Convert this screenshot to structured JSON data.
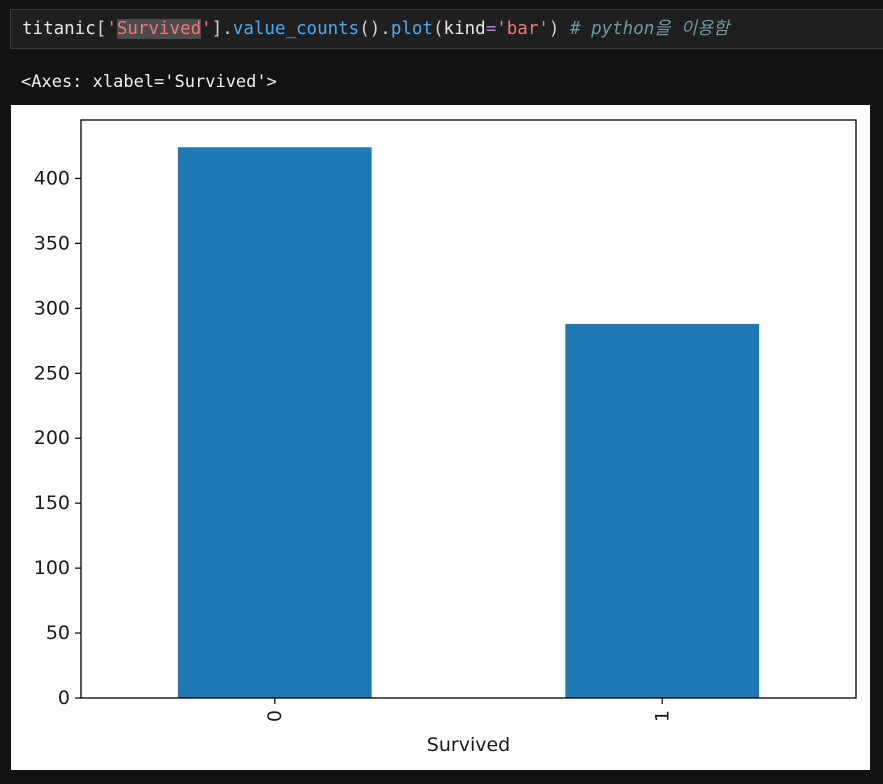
{
  "code_cell": {
    "tokens": [
      {
        "text": "titanic",
        "kind": "kw"
      },
      {
        "text": "[",
        "kind": "punc"
      },
      {
        "text": "'",
        "kind": "str"
      },
      {
        "text": "Survived",
        "kind": "str-hl"
      },
      {
        "text": "'",
        "kind": "str"
      },
      {
        "text": "].",
        "kind": "punc"
      },
      {
        "text": "value_counts",
        "kind": "fn"
      },
      {
        "text": "().",
        "kind": "punc"
      },
      {
        "text": "plot",
        "kind": "fn"
      },
      {
        "text": "(",
        "kind": "punc"
      },
      {
        "text": "kind",
        "kind": "kw"
      },
      {
        "text": "=",
        "kind": "op"
      },
      {
        "text": "'bar'",
        "kind": "str"
      },
      {
        "text": ") ",
        "kind": "punc"
      },
      {
        "text": "# python을 이용함",
        "kind": "comment"
      }
    ]
  },
  "output": {
    "repr_text": "<Axes: xlabel='Survived'>"
  },
  "chart_data": {
    "type": "bar",
    "categories": [
      "0",
      "1"
    ],
    "values": [
      424,
      288
    ],
    "title": "",
    "xlabel": "Survived",
    "ylabel": "",
    "ylim": [
      0,
      445
    ],
    "yticks": [
      0,
      50,
      100,
      150,
      200,
      250,
      300,
      350,
      400
    ],
    "x_tick_rotation": "vertical",
    "bar_color": "#1f77b4",
    "grid": false,
    "legend": "none"
  }
}
